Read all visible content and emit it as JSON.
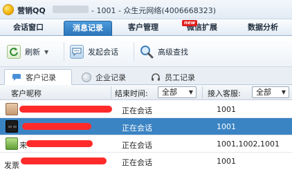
{
  "window": {
    "app_name": "营销QQ",
    "title": "- 1001 - 众生元网络(4006668323)"
  },
  "nav": {
    "tabs": [
      {
        "label": "会话窗口"
      },
      {
        "label": "消息记录"
      },
      {
        "label": "客户管理"
      },
      {
        "label": "微信扩展"
      },
      {
        "label": "数据分析"
      }
    ],
    "active_tab": "消息记录",
    "new_badge": "new"
  },
  "toolbar": {
    "refresh_label": "刷新",
    "start_chat_label": "发起会话",
    "advanced_search_label": "高级查找"
  },
  "subtabs": [
    {
      "label": "客户记录"
    },
    {
      "label": "企业记录"
    },
    {
      "label": "员工记录"
    }
  ],
  "table": {
    "columns": {
      "nickname": "客户昵称",
      "end_time": "结束时间:",
      "agent": "接入客服:"
    },
    "end_time_filter": "全部",
    "agent_filter": "全部",
    "rows": [
      {
        "status": "正在会话",
        "agent": "1001",
        "avatar": "man-avatar-icon"
      },
      {
        "status": "正在会话",
        "agent": "1001",
        "avatar": "sunglasses-avatar-icon"
      },
      {
        "status": "正在会话",
        "agent": "1001,1002,1001",
        "avatar": "plant-avatar-icon",
        "name_prefix": "来"
      },
      {
        "status": "正在会话",
        "agent": "1001",
        "avatar": "",
        "name_prefix": "发票"
      }
    ]
  },
  "colors": {
    "selected_row": "#3b84c4",
    "redaction": "#ff2b2b",
    "active_tab": "#2a73b8"
  }
}
